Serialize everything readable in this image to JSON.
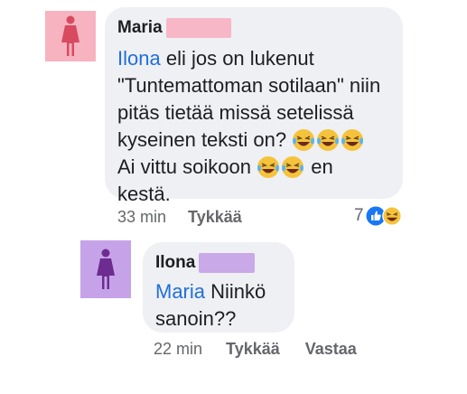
{
  "comment_main": {
    "author": "Maria",
    "author_redaction_color": "#f7b7c6",
    "avatar_bg": "#f7b3c0",
    "avatar_icon": "female-person-icon",
    "avatar_icon_color": "#d84a60",
    "mention": "Ilona",
    "lines": [
      " eli jos on lukenut",
      "\"Tuntemattoman sotilaan\" niin",
      "pitäs tietää missä setelissä",
      "kyseinen teksti on?",
      "Ai vittu soikoon",
      " en",
      "kestä."
    ],
    "time": "33 min",
    "like_label": "Tykkää",
    "reaction_count": "7",
    "reaction_icons": [
      "like-icon",
      "laughing-icon"
    ]
  },
  "comment_reply": {
    "author": "Ilona",
    "author_redaction_color": "#c9a9e8",
    "avatar_bg": "#c6a3e8",
    "avatar_icon": "female-person-icon",
    "avatar_icon_color": "#6d2c8f",
    "mention": "Maria",
    "lines": [
      " Niinkö",
      "sanoin??"
    ],
    "time": "22 min",
    "like_label": "Tykkää",
    "reply_label": "Vastaa"
  },
  "colors": {
    "bubble": "#eef0f3",
    "mention": "#216fdb",
    "meta": "#65676b",
    "like_blue": "#1877f2"
  }
}
